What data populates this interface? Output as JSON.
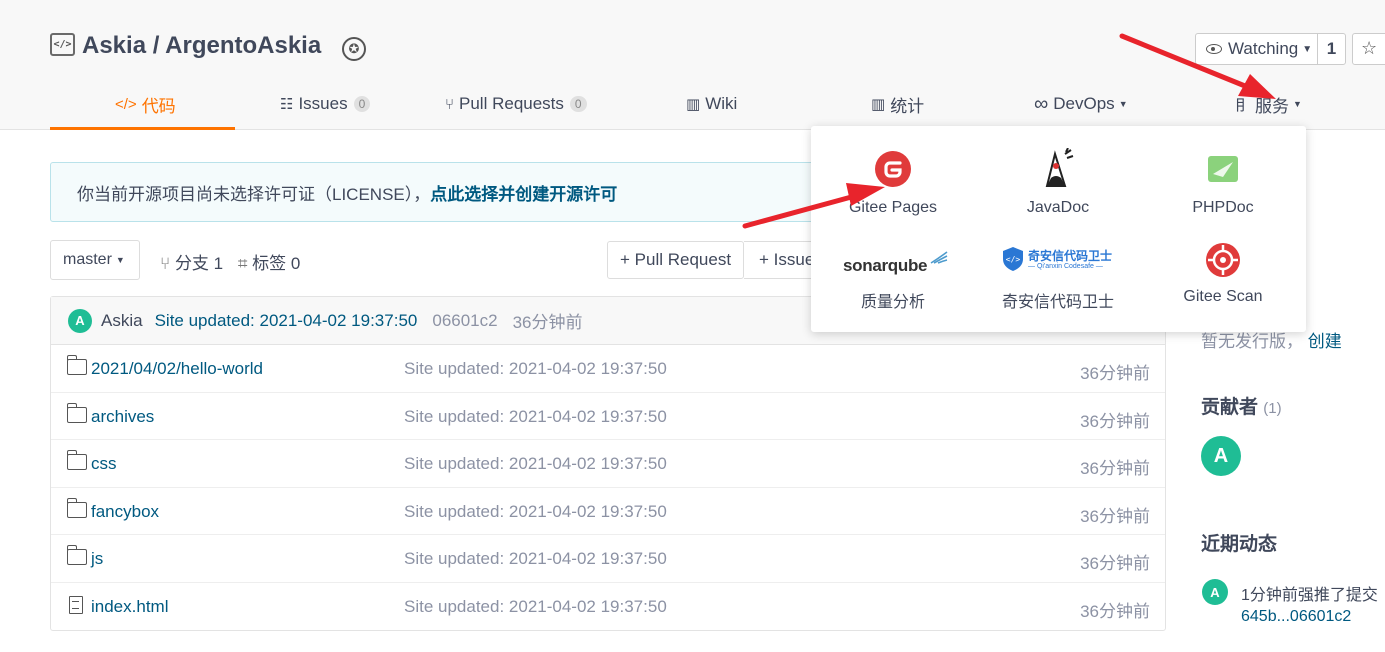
{
  "repo": {
    "title": "Askia / ArgentoAskia"
  },
  "watch": {
    "label": "Watching",
    "count": "1"
  },
  "tabs": [
    {
      "label": "代码"
    },
    {
      "label": "Issues",
      "badge": "0"
    },
    {
      "label": "Pull Requests",
      "badge": "0"
    },
    {
      "label": "Wiki"
    },
    {
      "label": "统计"
    },
    {
      "label": "DevOps"
    },
    {
      "label": "服务"
    }
  ],
  "notice": {
    "text": "你当前开源项目尚未选择许可证（LICENSE），",
    "link": "点此选择并创建开源许可"
  },
  "branch": {
    "name": "master",
    "branches_label": "分支 1",
    "tags_label": "标签 0"
  },
  "actions": {
    "pull_request": "+ Pull Request",
    "issue": "+ Issue"
  },
  "commit": {
    "avatar": "A",
    "author": "Askia",
    "message": "Site updated: 2021-04-02 19:37:50",
    "sha": "06601c2",
    "time": "36分钟前"
  },
  "files": [
    {
      "name": "2021/04/02/hello-world",
      "message": "Site updated: 2021-04-02 19:37:50",
      "time": "36分钟前",
      "type": "folder"
    },
    {
      "name": "archives",
      "message": "Site updated: 2021-04-02 19:37:50",
      "time": "36分钟前",
      "type": "folder"
    },
    {
      "name": "css",
      "message": "Site updated: 2021-04-02 19:37:50",
      "time": "36分钟前",
      "type": "folder"
    },
    {
      "name": "fancybox",
      "message": "Site updated: 2021-04-02 19:37:50",
      "time": "36分钟前",
      "type": "folder"
    },
    {
      "name": "js",
      "message": "Site updated: 2021-04-02 19:37:50",
      "time": "36分钟前",
      "type": "folder"
    },
    {
      "name": "index.html",
      "message": "Site updated: 2021-04-02 19:37:50",
      "time": "36分钟前",
      "type": "file"
    }
  ],
  "sidebar": {
    "release_text": "暂无发行版，",
    "release_link": "创建",
    "contributors_heading": "贡献者",
    "contributors_count": "(1)",
    "contributor_avatar": "A",
    "activity_heading": "近期动态",
    "activity_avatar": "A",
    "activity_text": "1分钟前强推了提交",
    "activity_link": "645b...06601c2"
  },
  "services": {
    "items": [
      {
        "label": "Gitee Pages",
        "icon": "gitee-pages-logo",
        "color": "#e03b3b"
      },
      {
        "label": "JavaDoc",
        "icon": "javadoc-duke-logo"
      },
      {
        "label": "PHPDoc",
        "icon": "phpdoc-logo",
        "color": "#8bd27c"
      },
      {
        "label": "质量分析",
        "icon": "sonarqube-logo",
        "logo_text": "sonarqube"
      },
      {
        "label": "奇安信代码卫士",
        "icon": "qianxin-logo",
        "logo_text": "奇安信代码卫士",
        "logo_sub": "— Qi'anxin Codesafe —",
        "color": "#2a77d4"
      },
      {
        "label": "Gitee Scan",
        "icon": "gitee-scan-logo",
        "color": "#e03b3b"
      }
    ]
  },
  "colors": {
    "accent": "#fe7300",
    "link": "#005980",
    "avatar": "#1fbd95",
    "annotation_arrow": "#e8242c"
  }
}
